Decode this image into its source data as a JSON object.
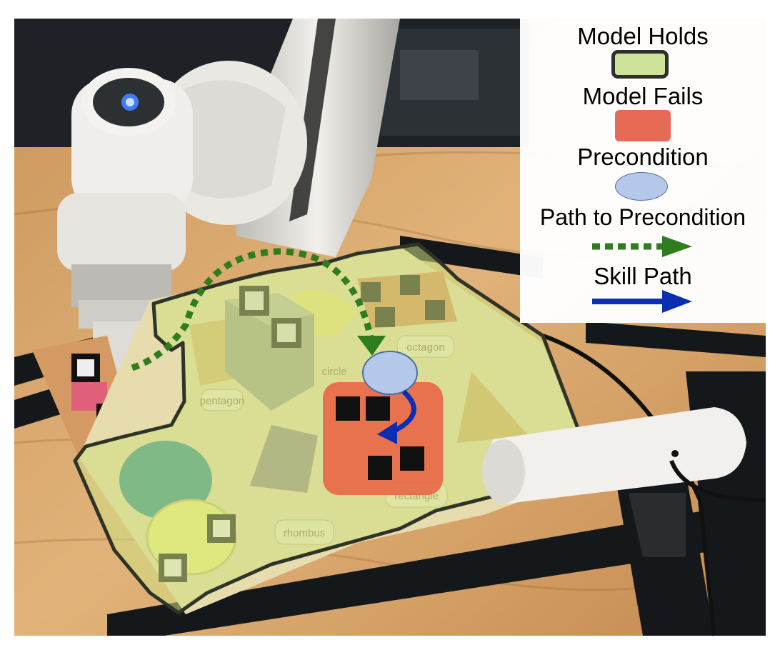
{
  "legend": {
    "model_holds": "Model Holds",
    "model_fails": "Model Fails",
    "precondition": "Precondition",
    "path_to_precondition": "Path to Precondition",
    "skill_path": "Skill Path"
  },
  "colors": {
    "hold": "#cfe29a",
    "hold_border": "#2e2e2e",
    "fail": "#e76a57",
    "precondition": "#b4c9ea",
    "path": "#2f7d1e",
    "skill": "#0a2fb3"
  },
  "board_labels": {
    "pentagon": "pentagon",
    "circle": "circle",
    "octagon": "octagon",
    "rhombus": "rhombus",
    "rectangle": "rectangle"
  }
}
